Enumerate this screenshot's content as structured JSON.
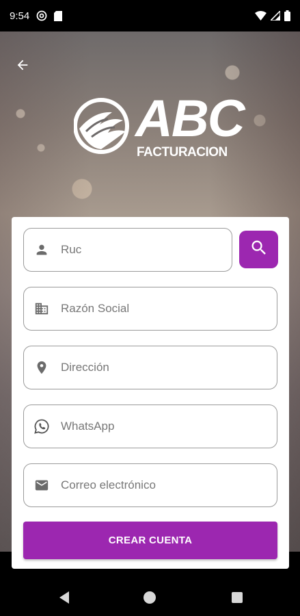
{
  "status_bar": {
    "time": "9:54",
    "icons": [
      "at-sign-icon",
      "sd-card-icon",
      "wifi-icon",
      "signal-icon",
      "battery-icon"
    ]
  },
  "header": {
    "back_icon": "arrow-left-icon"
  },
  "logo": {
    "brand": "ABC",
    "tagline": "FACTURACION"
  },
  "form": {
    "ruc": {
      "placeholder": "Ruc",
      "value": "",
      "icon": "person-icon"
    },
    "razon_social": {
      "placeholder": "Razón Social",
      "value": "",
      "icon": "building-icon"
    },
    "direccion": {
      "placeholder": "Dirección",
      "value": "",
      "icon": "location-pin-icon"
    },
    "whatsapp": {
      "placeholder": "WhatsApp",
      "value": "",
      "icon": "whatsapp-icon"
    },
    "correo": {
      "placeholder": "Correo electrónico",
      "value": "",
      "icon": "mail-icon"
    },
    "search_icon": "search-icon",
    "submit_label": "CREAR CUENTA"
  },
  "colors": {
    "accent": "#9c27b0",
    "field_border": "#9a9a9a",
    "icon_gray": "#6b6b6b"
  },
  "nav_bar": {
    "icons": [
      "nav-back-icon",
      "nav-home-icon",
      "nav-recent-icon"
    ]
  }
}
